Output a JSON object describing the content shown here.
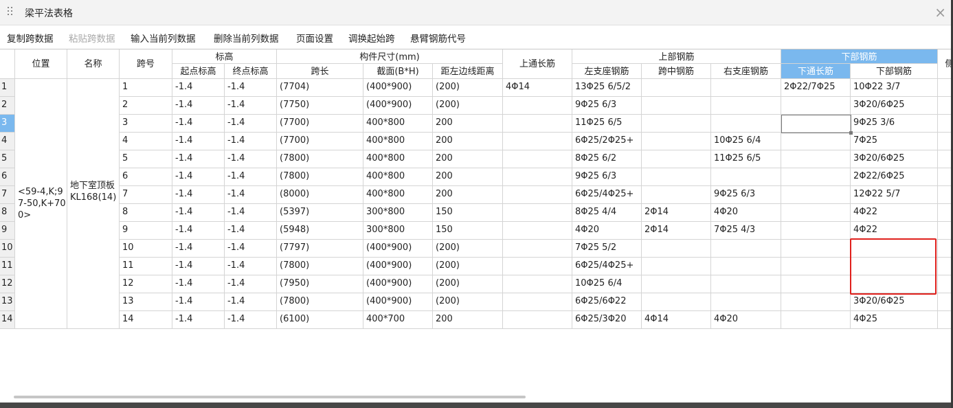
{
  "window": {
    "title": "梁平法表格",
    "close": "×"
  },
  "toolbar": [
    {
      "label": "复制跨数据",
      "enabled": true
    },
    {
      "label": "粘贴跨数据",
      "enabled": false
    },
    {
      "label": "输入当前列数据",
      "enabled": true
    },
    {
      "label": "删除当前列数据",
      "enabled": true
    },
    {
      "label": "页面设置",
      "enabled": true
    },
    {
      "label": "调换起始跨",
      "enabled": true
    },
    {
      "label": "悬臂钢筋代号",
      "enabled": true
    }
  ],
  "headers": {
    "position": "位置",
    "name": "名称",
    "span_no": "跨号",
    "elevation": "标高",
    "start_elev": "起点标高",
    "end_elev": "终点标高",
    "size": "构件尺寸(mm)",
    "span_len": "跨长",
    "section": "截面(B*H)",
    "left_dist": "距左边线距离",
    "top_cont": "上通长筋",
    "top_rebar": "上部钢筋",
    "left_support": "左支座钢筋",
    "mid_span": "跨中钢筋",
    "right_support": "右支座钢筋",
    "bottom_rebar": "下部钢筋",
    "bottom_cont": "下通长筋",
    "bottom_rebar2": "下部钢筋",
    "side": "侧"
  },
  "merged": {
    "position": "<59-4,K;97-50,K+700>",
    "name": "地下室顶板KL168(14)"
  },
  "selected_row": 3,
  "rows": [
    {
      "n": "1",
      "span": "1",
      "se": "-1.4",
      "ee": "-1.4",
      "len": "(7704)",
      "sec": "(400*900)",
      "dist": "(200)",
      "topc": "4Φ14",
      "ls": "13Φ25 6/5/2",
      "mid": "",
      "rs": "",
      "botc": "2Φ22/7Φ25",
      "bot": "10Φ22 3/7"
    },
    {
      "n": "2",
      "span": "2",
      "se": "-1.4",
      "ee": "-1.4",
      "len": "(7750)",
      "sec": "(400*900)",
      "dist": "(200)",
      "topc": "",
      "ls": "9Φ25 6/3",
      "mid": "",
      "rs": "",
      "botc": "",
      "bot": "3Φ20/6Φ25"
    },
    {
      "n": "3",
      "span": "3",
      "se": "-1.4",
      "ee": "-1.4",
      "len": "(7700)",
      "sec": "400*800",
      "dist": "200",
      "topc": "",
      "ls": "11Φ25 6/5",
      "mid": "",
      "rs": "",
      "botc": "",
      "bot": "9Φ25 3/6"
    },
    {
      "n": "4",
      "span": "4",
      "se": "-1.4",
      "ee": "-1.4",
      "len": "(7700)",
      "sec": "400*800",
      "dist": "200",
      "topc": "",
      "ls": "6Φ25/2Φ25+",
      "mid": "",
      "rs": "10Φ25 6/4",
      "botc": "",
      "bot": "7Φ25"
    },
    {
      "n": "5",
      "span": "5",
      "se": "-1.4",
      "ee": "-1.4",
      "len": "(7800)",
      "sec": "400*800",
      "dist": "200",
      "topc": "",
      "ls": "8Φ25 6/2",
      "mid": "",
      "rs": "11Φ25 6/5",
      "botc": "",
      "bot": "3Φ20/6Φ25"
    },
    {
      "n": "6",
      "span": "6",
      "se": "-1.4",
      "ee": "-1.4",
      "len": "(7800)",
      "sec": "400*800",
      "dist": "200",
      "topc": "",
      "ls": "9Φ25 6/3",
      "mid": "",
      "rs": "",
      "botc": "",
      "bot": "2Φ22/6Φ25"
    },
    {
      "n": "7",
      "span": "7",
      "se": "-1.4",
      "ee": "-1.4",
      "len": "(8000)",
      "sec": "400*800",
      "dist": "200",
      "topc": "",
      "ls": "6Φ25/4Φ25+",
      "mid": "",
      "rs": "9Φ25 6/3",
      "botc": "",
      "bot": "12Φ22 5/7"
    },
    {
      "n": "8",
      "span": "8",
      "se": "-1.4",
      "ee": "-1.4",
      "len": "(5397)",
      "sec": "300*800",
      "dist": "150",
      "topc": "",
      "ls": "8Φ25 4/4",
      "mid": "2Φ14",
      "rs": "4Φ20",
      "botc": "",
      "bot": "4Φ22"
    },
    {
      "n": "9",
      "span": "9",
      "se": "-1.4",
      "ee": "-1.4",
      "len": "(5948)",
      "sec": "300*800",
      "dist": "150",
      "topc": "",
      "ls": "4Φ20",
      "mid": "2Φ14",
      "rs": "7Φ25 4/3",
      "botc": "",
      "bot": "4Φ22"
    },
    {
      "n": "10",
      "span": "10",
      "se": "-1.4",
      "ee": "-1.4",
      "len": "(7797)",
      "sec": "(400*900)",
      "dist": "(200)",
      "topc": "",
      "ls": "7Φ25 5/2",
      "mid": "",
      "rs": "",
      "botc": "",
      "bot": ""
    },
    {
      "n": "11",
      "span": "11",
      "se": "-1.4",
      "ee": "-1.4",
      "len": "(7800)",
      "sec": "(400*900)",
      "dist": "(200)",
      "topc": "",
      "ls": "6Φ25/4Φ25+",
      "mid": "",
      "rs": "",
      "botc": "",
      "bot": ""
    },
    {
      "n": "12",
      "span": "12",
      "se": "-1.4",
      "ee": "-1.4",
      "len": "(7950)",
      "sec": "(400*900)",
      "dist": "(200)",
      "topc": "",
      "ls": "10Φ25 6/4",
      "mid": "",
      "rs": "",
      "botc": "",
      "bot": ""
    },
    {
      "n": "13",
      "span": "13",
      "se": "-1.4",
      "ee": "-1.4",
      "len": "(7800)",
      "sec": "(400*900)",
      "dist": "(200)",
      "topc": "",
      "ls": "6Φ25/6Φ22",
      "mid": "",
      "rs": "",
      "botc": "",
      "bot": "3Φ20/6Φ25"
    },
    {
      "n": "14",
      "span": "14",
      "se": "-1.4",
      "ee": "-1.4",
      "len": "(6100)",
      "sec": "400*700",
      "dist": "200",
      "topc": "",
      "ls": "6Φ25/3Φ20",
      "mid": "4Φ14",
      "rs": "4Φ20",
      "botc": "",
      "bot": "4Φ25"
    }
  ]
}
